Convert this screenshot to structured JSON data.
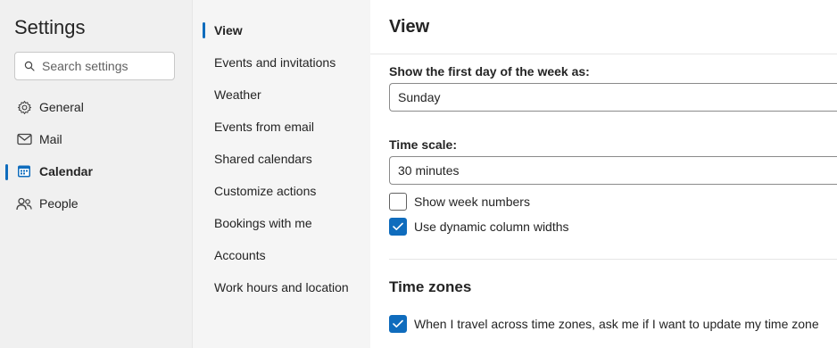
{
  "settings": {
    "title": "Settings"
  },
  "search": {
    "placeholder": "Search settings"
  },
  "categories": [
    {
      "label": "General",
      "icon": "gear-icon",
      "active": false
    },
    {
      "label": "Mail",
      "icon": "mail-icon",
      "active": false
    },
    {
      "label": "Calendar",
      "icon": "calendar-icon",
      "active": true
    },
    {
      "label": "People",
      "icon": "people-icon",
      "active": false
    }
  ],
  "subnav": [
    {
      "label": "View",
      "active": true
    },
    {
      "label": "Events and invitations"
    },
    {
      "label": "Weather"
    },
    {
      "label": "Events from email"
    },
    {
      "label": "Shared calendars"
    },
    {
      "label": "Customize actions"
    },
    {
      "label": "Bookings with me"
    },
    {
      "label": "Accounts"
    },
    {
      "label": "Work hours and location"
    }
  ],
  "main": {
    "title": "View",
    "first_day": {
      "label": "Show the first day of the week as:",
      "value": "Sunday"
    },
    "time_scale": {
      "label": "Time scale:",
      "value": "30 minutes"
    },
    "show_week_numbers": {
      "label": "Show week numbers",
      "checked": false
    },
    "dynamic_columns": {
      "label": "Use dynamic column widths",
      "checked": true
    },
    "time_zones": {
      "title": "Time zones",
      "travel": {
        "label": "When I travel across time zones, ask me if I want to update my time zone",
        "checked": true
      }
    }
  },
  "colors": {
    "accent": "#0f6cbd",
    "nav_bg": "#f0f0f0",
    "subnav_bg": "#f5f5f5"
  }
}
